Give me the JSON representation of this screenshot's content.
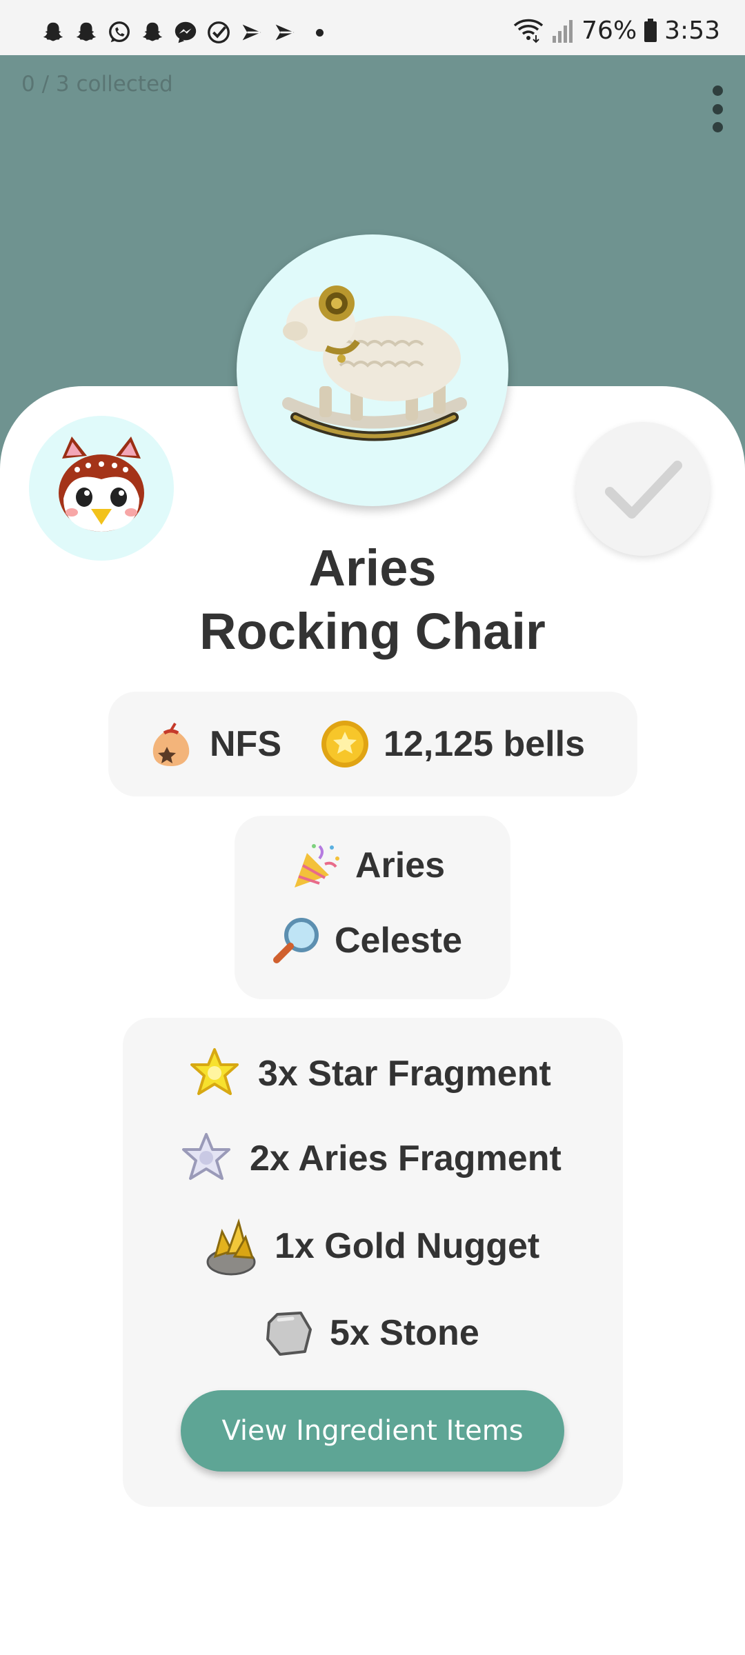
{
  "status_bar": {
    "left_icons": [
      "snapchat-icon",
      "snapchat-icon",
      "whatsapp-icon",
      "snapchat-icon",
      "messenger-icon",
      "check-circle-icon",
      "play-store-icon",
      "play-store-icon"
    ],
    "battery_percent": "76%",
    "time": "3:53"
  },
  "header": {
    "collected_text": "0 / 3 collected",
    "background_color": "#6f9390"
  },
  "item": {
    "title_line1": "Aries",
    "title_line2": "Rocking Chair",
    "image_icon": "aries-rocking-chair-icon",
    "villager_icon": "celeste-owl-icon",
    "collected": false
  },
  "price": {
    "buy_label": "NFS",
    "sell_label": "12,125 bells"
  },
  "source": {
    "event_label": "Aries",
    "npc_label": "Celeste"
  },
  "recipe": {
    "ingredients": [
      {
        "label": "3x Star Fragment",
        "icon": "star-fragment-icon"
      },
      {
        "label": "2x Aries Fragment",
        "icon": "aries-fragment-icon"
      },
      {
        "label": "1x Gold Nugget",
        "icon": "gold-nugget-icon"
      },
      {
        "label": "5x Stone",
        "icon": "stone-icon"
      }
    ],
    "button_label": "View Ingredient Items"
  },
  "colors": {
    "accent": "#5ea595",
    "panel": "#f6f6f6",
    "circle_bg": "#e0fafa"
  }
}
